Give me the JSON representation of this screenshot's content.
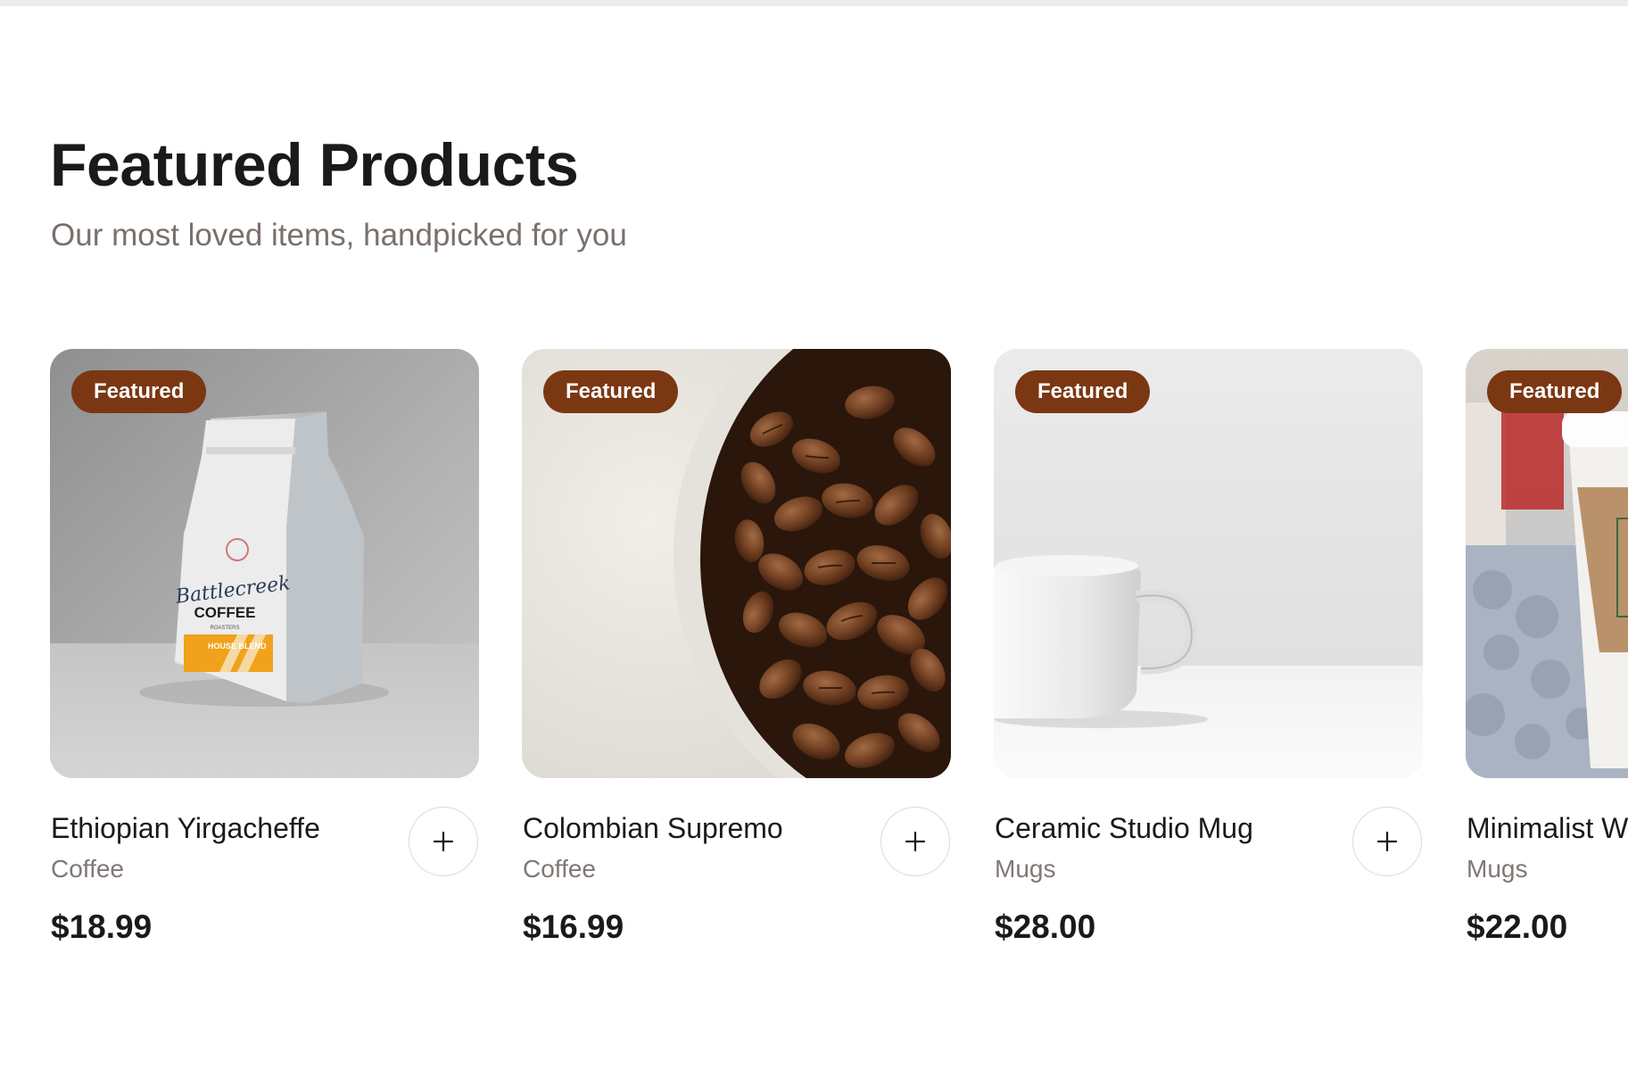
{
  "section": {
    "title": "Featured Products",
    "subtitle": "Our most loved items, handpicked for you"
  },
  "colors": {
    "badge": "#7a3712",
    "title": "#1a1a1a",
    "muted": "#7f7875"
  },
  "products": [
    {
      "badge": "Featured",
      "name": "Ethiopian Yirgacheffe",
      "category": "Coffee",
      "price": "$18.99",
      "image_icon": "coffee-bag-photo",
      "add_icon": "plus-icon",
      "image_labels": [
        "Battlecreek",
        "COFFEE",
        "ROASTERS",
        "HOUSE BLEND"
      ]
    },
    {
      "badge": "Featured",
      "name": "Colombian Supremo",
      "category": "Coffee",
      "price": "$16.99",
      "image_icon": "coffee-beans-bowl-photo",
      "add_icon": "plus-icon"
    },
    {
      "badge": "Featured",
      "name": "Ceramic Studio Mug",
      "category": "Mugs",
      "price": "$28.00",
      "image_icon": "white-mug-photo",
      "add_icon": "plus-icon"
    },
    {
      "badge": "Featured",
      "name": "Minimalist W",
      "category": "Mugs",
      "price": "$22.00",
      "image_icon": "takeaway-cup-photo",
      "add_icon": "plus-icon"
    }
  ]
}
